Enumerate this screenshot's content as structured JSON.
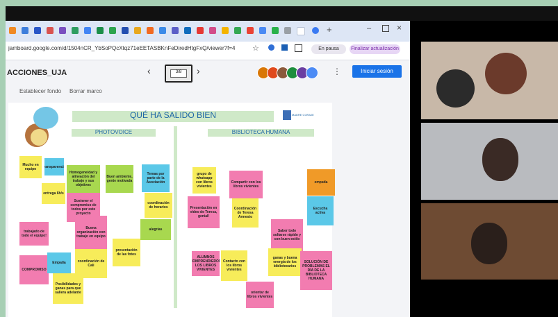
{
  "browser": {
    "url": "jamboard.google.com/d/1504nCR_YbSoPQcXtqz71eEETASBKnFeDiredHtgFxQ/viewer?f=4",
    "buttons": [
      "En pausa",
      "Finalizar actualización"
    ]
  },
  "app": {
    "title": "ACCIONES_UJA",
    "frame_indicator": "3/8",
    "signin_label": "Iniciar sesión",
    "toolbar": [
      "Establecer fondo",
      "Borrar marco"
    ]
  },
  "board": {
    "title": "QUÉ HA SALIDO BIEN",
    "logo_text": "MADRE CORAJE",
    "section_left": "PHOTOVOICE",
    "section_right": "BIBLIOTECA HUMANA",
    "notes": [
      "Mucho en equipo",
      "transparencia",
      "entrega 6h/s",
      "trabajado de todo el equipo!",
      "COMPROMISO",
      "Empatía",
      "Posibilidades y ganas para que saliera adelante",
      "Homogeneidad y alineación del trabajo y sus objetivos",
      "Sostener el compromiso de todos por este proyecto",
      "Buena organización con trabajo en equipo",
      "coordinación de Cali",
      "Buen ambiente, gente motivada",
      "presentación de las fotos",
      "Temas por parte de la Asociación",
      "coordinación de horarios",
      "alegrías",
      "grupo de whatsapp con libros vivientes",
      "Presentación en vídeo de Teresa, genial!",
      "Compartir con los libros vivientes",
      "Coordinación de Teresa Armesto",
      "Contacto con los libros vivientes",
      "Saber todo soltarse rápido y con buen estilo",
      "ganas y buena energía de los bibliotecarios",
      "empatía",
      "Escucha activa",
      "SOLUCIÓN DE PROBLEMAS EL DÍA DE LA BIBLIOTECA HUMANA",
      "orientar de libros vivientes",
      "ALUMNOS COMPRENDIERON LOS LIBROS VIVIENTES"
    ]
  },
  "colors": {
    "background_frame": "#a7cfb4",
    "primary_button": "#1a73e8"
  }
}
